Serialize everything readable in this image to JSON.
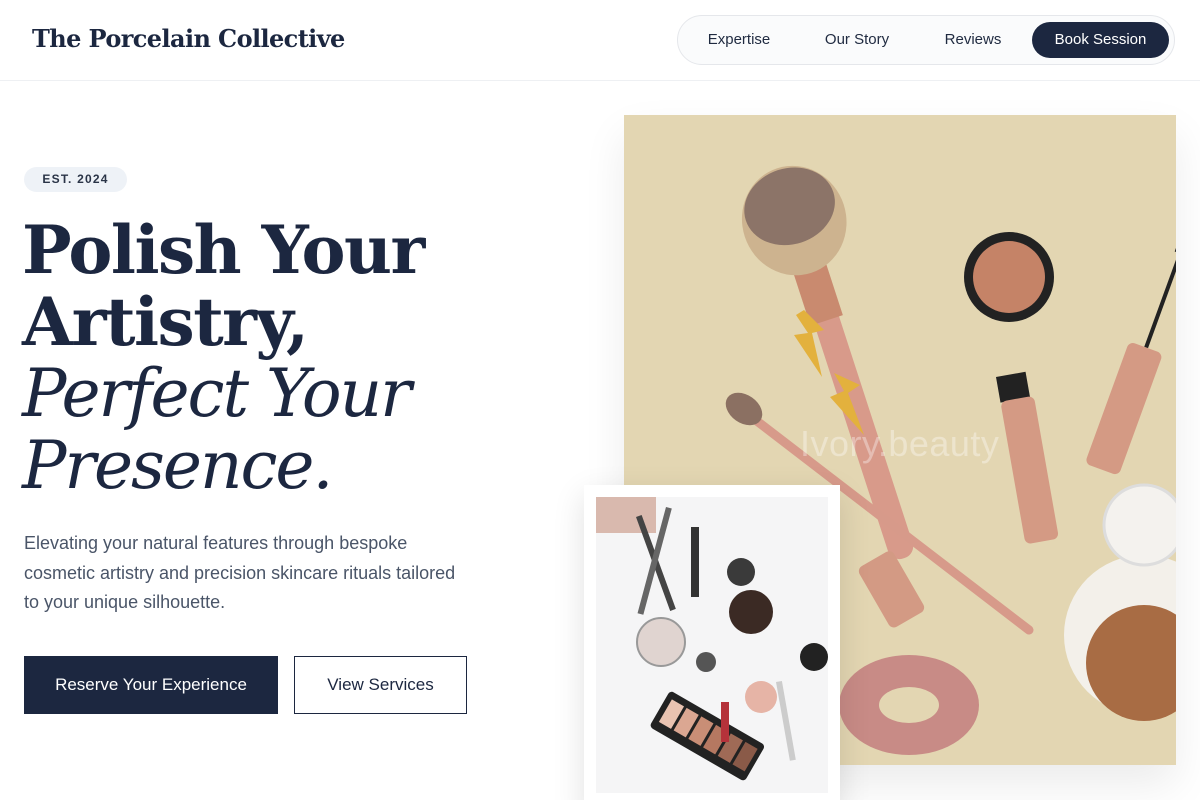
{
  "brand": {
    "name": "The Porcelain Collective"
  },
  "nav": {
    "items": [
      {
        "label": "Expertise"
      },
      {
        "label": "Our Story"
      },
      {
        "label": "Reviews"
      }
    ],
    "cta": "Book Session"
  },
  "hero": {
    "badge": "EST. 2024",
    "headline": {
      "line1": "Polish Your",
      "line2": "Artistry,",
      "line3": "Perfect Your",
      "line4": "Presence."
    },
    "description": "Elevating your natural features through bespoke cosmetic artistry and precision skincare rituals tailored to your unique silhouette.",
    "primary_button": "Reserve Your Experience",
    "secondary_button": "View Services"
  },
  "images": {
    "main": {
      "watermark": "Ivory.beauty"
    }
  },
  "colors": {
    "navy": "#1c2740",
    "beige": "#e3d6b2",
    "rose": "#d79a8a"
  }
}
